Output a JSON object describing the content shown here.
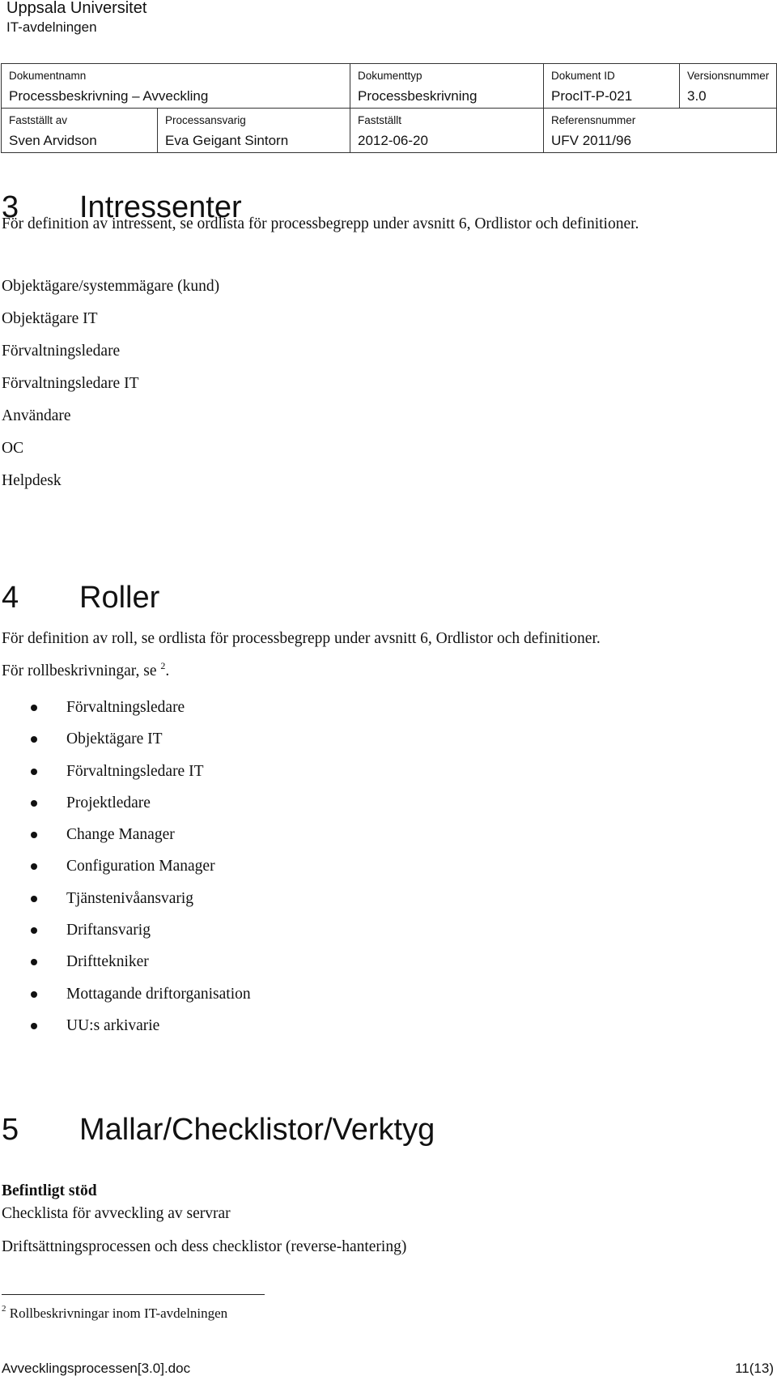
{
  "header": {
    "organization": "Uppsala Universitet",
    "department": "IT-avdelningen"
  },
  "meta_table": {
    "document_name": {
      "label": "Dokumentnamn",
      "value": "Processbeskrivning – Avveckling"
    },
    "document_type": {
      "label": "Dokumenttyp",
      "value": "Processbeskrivning"
    },
    "document_id": {
      "label": "Dokument ID",
      "value": "ProcIT-P-021"
    },
    "version": {
      "label": "Versionsnummer",
      "value": "3.0"
    },
    "approved_by": {
      "label": "Fastställt av",
      "value": "Sven Arvidson"
    },
    "process_owner": {
      "label": "Processansvarig",
      "value": "Eva Geigant Sintorn"
    },
    "approved_date": {
      "label": "Fastställt",
      "value": "2012-06-20"
    },
    "reference": {
      "label": "Referensnummer",
      "value": "UFV 2011/96"
    }
  },
  "sections": {
    "s3": {
      "number": "3",
      "title": "Intressenter",
      "intro": "För definition av intressent, se ordlista för processbegrepp under avsnitt 6, Ordlistor och definitioner.",
      "items": [
        "Objektägare/systemmägare (kund)",
        "Objektägare IT",
        "Förvaltningsledare",
        "Förvaltningsledare IT",
        "Användare",
        "OC",
        "Helpdesk"
      ]
    },
    "s4": {
      "number": "4",
      "title": "Roller",
      "intro": "För definition av roll, se ordlista för processbegrepp under avsnitt 6, Ordlistor och definitioner.",
      "roles_ref_text": "För rollbeskrivningar, se ",
      "roles_ref_footnote": "2",
      "roles_ref_end": ".",
      "items": [
        "Förvaltningsledare",
        "Objektägare IT",
        "Förvaltningsledare IT",
        "Projektledare",
        "Change Manager",
        "Configuration Manager",
        "Tjänstenivåansvarig",
        "Driftansvarig",
        "Drifttekniker",
        "Mottagande driftorganisation",
        "UU:s arkivarie"
      ]
    },
    "s5": {
      "number": "5",
      "title": "Mallar/Checklistor/Verktyg",
      "subheading": "Befintligt stöd",
      "lines": [
        "Checklista för avveckling av servrar",
        "Driftsättningsprocessen och dess checklistor (reverse-hantering)"
      ]
    }
  },
  "footnote": {
    "marker": "2",
    "text": " Rollbeskrivningar inom IT-avdelningen"
  },
  "footer": {
    "filename": "Avvecklingsprocessen[3.0].doc",
    "page": "11(13)"
  }
}
